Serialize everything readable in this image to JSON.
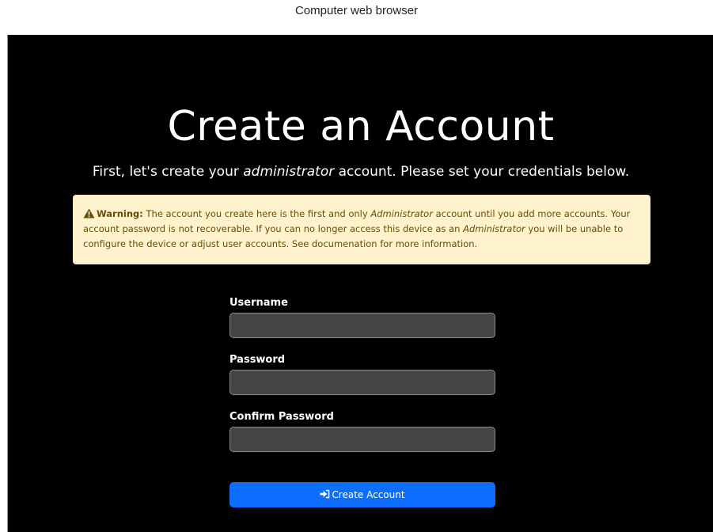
{
  "window": {
    "caption": "Computer web browser"
  },
  "page": {
    "title": "Create an Account",
    "subtitle": {
      "before": "First, let's create your ",
      "emphasis": "administrator",
      "after": " account. Please set your credentials below."
    }
  },
  "warning": {
    "icon": "warning-triangle-icon",
    "label": "Warning:",
    "text1": " The account you create here is the first and only ",
    "em1": "Administrator",
    "text2": " account until you add more accounts. Your account password is not recoverable. If you can no longer access this device as an ",
    "em2": "Administrator",
    "text3": " you will be unable to configure the device or adjust user accounts. See documenation for more information.",
    "colors": {
      "background": "#fff3cd",
      "text": "#664d03"
    }
  },
  "form": {
    "username_label": "Username",
    "username_value": "",
    "password_label": "Password",
    "password_value": "",
    "confirm_label": "Confirm Password",
    "confirm_value": "",
    "submit_label": "Create Account",
    "submit_icon": "sign-in-icon",
    "colors": {
      "submit": "#0d6efd",
      "input_bg": "#454545"
    }
  }
}
